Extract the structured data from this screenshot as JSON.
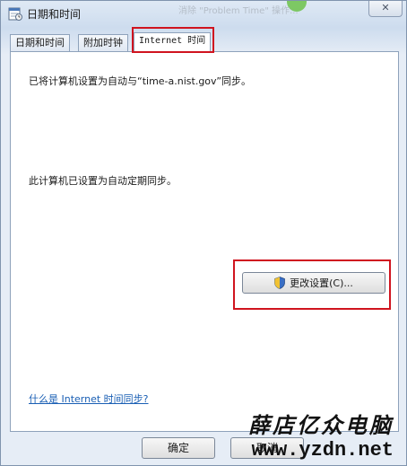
{
  "window": {
    "title": "日期和时间",
    "close_label": "✕",
    "background_window_text": "消除 \"Problem Time\" 操作..."
  },
  "tabs": [
    {
      "label": "日期和时间"
    },
    {
      "label": "附加时钟"
    },
    {
      "label": "Internet 时间"
    }
  ],
  "active_tab": "Internet 时间",
  "panel": {
    "sync_message": "已将计算机设置为自动与“time-a.nist.gov”同步。",
    "auto_sync_message": "此计算机已设置为自动定期同步。",
    "change_settings_label": "更改设置(C)...",
    "help_link_label": "什么是 Internet 时间同步?"
  },
  "footer": {
    "ok_label": "确定",
    "cancel_label": "取消"
  },
  "watermark": {
    "site_name": "薛店亿众电脑",
    "url": "www.yzdn.net"
  },
  "colors": {
    "highlight": "#d0141f",
    "link": "#1a5fb4",
    "frame": "#cddcee"
  },
  "icons": {
    "app": "calendar-clock-icon",
    "button": "uac-shield-icon"
  }
}
